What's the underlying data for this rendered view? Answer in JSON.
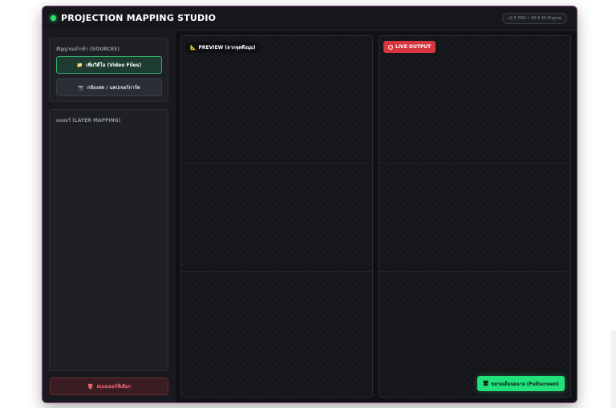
{
  "app": {
    "title": "PROJECTION MAPPING STUDIO",
    "version": "v2.5 PRO • 16:9 4K Engine",
    "status_color": "#2ee06a"
  },
  "sidebar": {
    "sources_label": "สัญญาณนำเข้า (SOURCES)",
    "video_button": {
      "icon": "folder-icon",
      "glyph": "📁",
      "label": "เพิ่มวิดีโอ (Video Files)"
    },
    "camera_button": {
      "icon": "camera-icon",
      "glyph": "📷",
      "label": "กล้องสด / แคปเจอร์การ์ด"
    },
    "layers_label": "เลเยอร์ (LAYER MAPPING)",
    "delete_button": {
      "icon": "trash-icon",
      "glyph": "🗑",
      "label": "ลบเลเยอร์ที่เลือก"
    }
  },
  "preview": {
    "icon": "ruler-icon",
    "glyph": "📐",
    "label": "PREVIEW (ลากจุดดึงมุม)"
  },
  "output": {
    "label": "LIVE OUTPUT",
    "color": "#d8363f"
  },
  "fullscreen_button": {
    "icon": "screen-icon",
    "glyph": "🖥",
    "label": "ขยายเต็มจอฉาย (Fullscreen)",
    "color": "#22e07a"
  }
}
